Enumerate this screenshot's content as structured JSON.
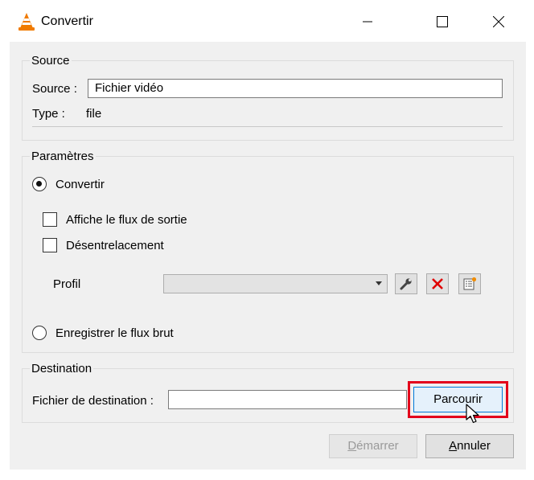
{
  "window": {
    "title": "Convertir",
    "icon": "vlc-cone-icon",
    "controls": [
      "minimize-icon",
      "maximize-icon",
      "close-icon"
    ]
  },
  "source": {
    "group_title": "Source",
    "source_label": "Source :",
    "source_value": "Fichier vidéo",
    "type_label": "Type :",
    "type_value": "file"
  },
  "params": {
    "group_title": "Paramètres",
    "convert_label": "Convertir",
    "convert_selected": true,
    "show_output_label": "Affiche le flux de sortie",
    "show_output_checked": false,
    "deinterlace_label": "Désentrelacement",
    "deinterlace_checked": false,
    "profile_label": "Profil",
    "profile_value": "",
    "raw_dump_label": "Enregistrer le flux brut",
    "raw_dump_selected": false
  },
  "destination": {
    "group_title": "Destination",
    "file_label": "Fichier de destination :",
    "file_value": "",
    "browse_label": "Parcourir"
  },
  "buttons": {
    "start_label": "Démarrer",
    "start_mnemonic": "D",
    "cancel_label": "Annuler",
    "cancel_mnemonic": "A"
  },
  "colors": {
    "highlight": "#e3001b",
    "delete_icon": "#e00000",
    "vlc_orange": "#f07b00"
  }
}
